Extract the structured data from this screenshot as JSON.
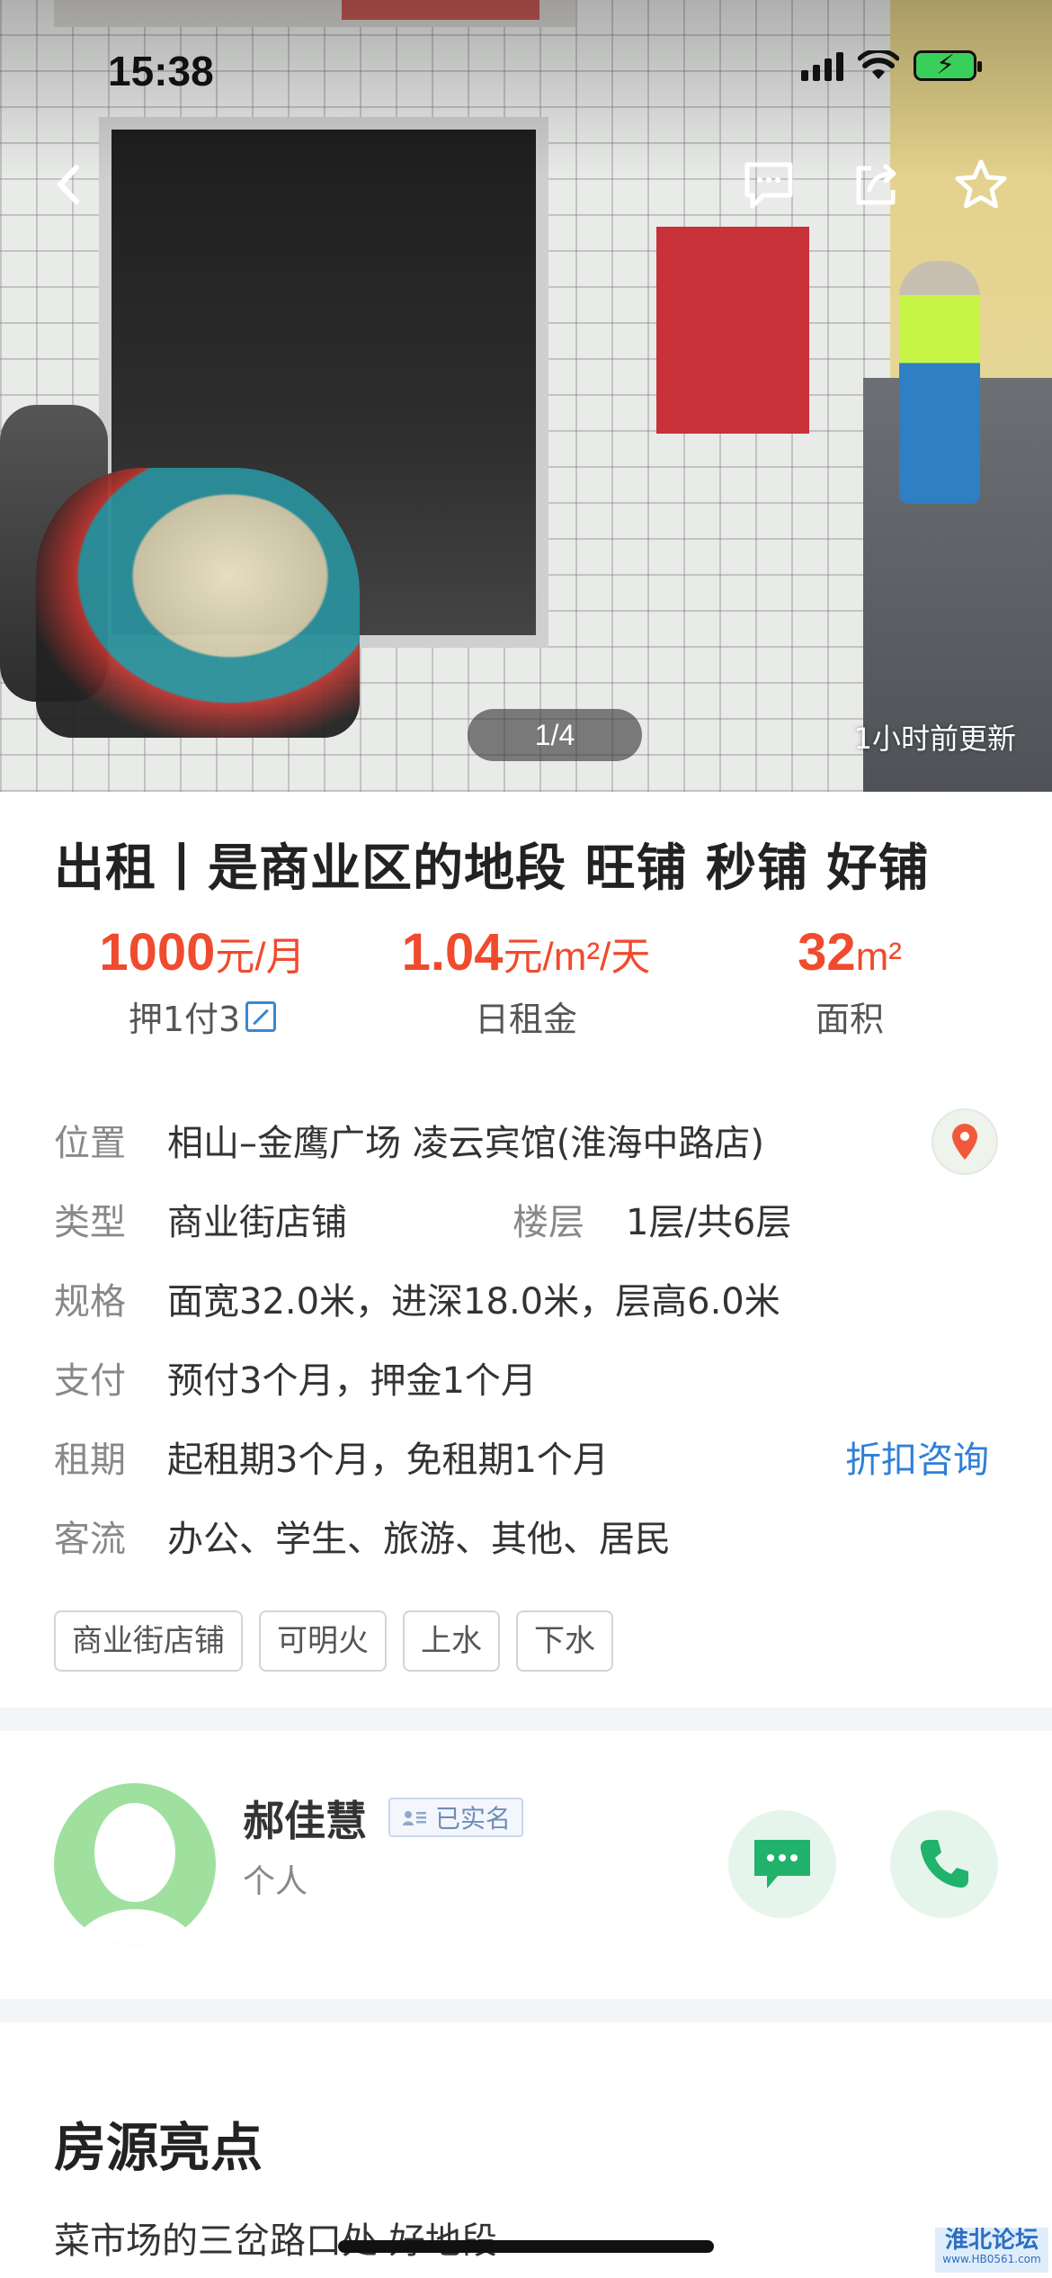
{
  "status_bar": {
    "time": "15:38"
  },
  "gallery": {
    "page_indicator": "1/4",
    "updated": "1小时前更新"
  },
  "listing": {
    "title": "出租丨是商业区的地段 旺铺 秒铺 好铺",
    "rent": {
      "value": "1000",
      "unit": "元/月",
      "label": "押1付3"
    },
    "daily": {
      "value": "1.04",
      "unit": "元/m²/天",
      "label": "日租金"
    },
    "area": {
      "value": "32",
      "unit": "m²",
      "label": "面积"
    }
  },
  "details": {
    "location": {
      "label": "位置",
      "value": "相山–金鹰广场 凌云宾馆(淮海中路店)"
    },
    "type": {
      "label": "类型",
      "value": "商业街店铺"
    },
    "floor": {
      "label": "楼层",
      "value": "1层/共6层"
    },
    "spec": {
      "label": "规格",
      "value": "面宽32.0米，进深18.0米，层高6.0米"
    },
    "payment": {
      "label": "支付",
      "value": "预付3个月，押金1个月"
    },
    "lease": {
      "label": "租期",
      "value": "起租期3个月，免租期1个月",
      "link": "折扣咨询"
    },
    "traffic": {
      "label": "客流",
      "value": "办公、学生、旅游、其他、居民"
    }
  },
  "tags": [
    "商业街店铺",
    "可明火",
    "上水",
    "下水"
  ],
  "agent": {
    "name": "郝佳慧",
    "verified": "已实名",
    "type": "个人"
  },
  "highlights": {
    "title": "房源亮点",
    "text": "菜市场的三岔路口处 好地段"
  },
  "watermark": {
    "main": "淮北论坛",
    "sub": "www.HB0561.com"
  },
  "colors": {
    "price": "#f04b2e",
    "link": "#2f80d6",
    "contact": "#21b26b"
  }
}
